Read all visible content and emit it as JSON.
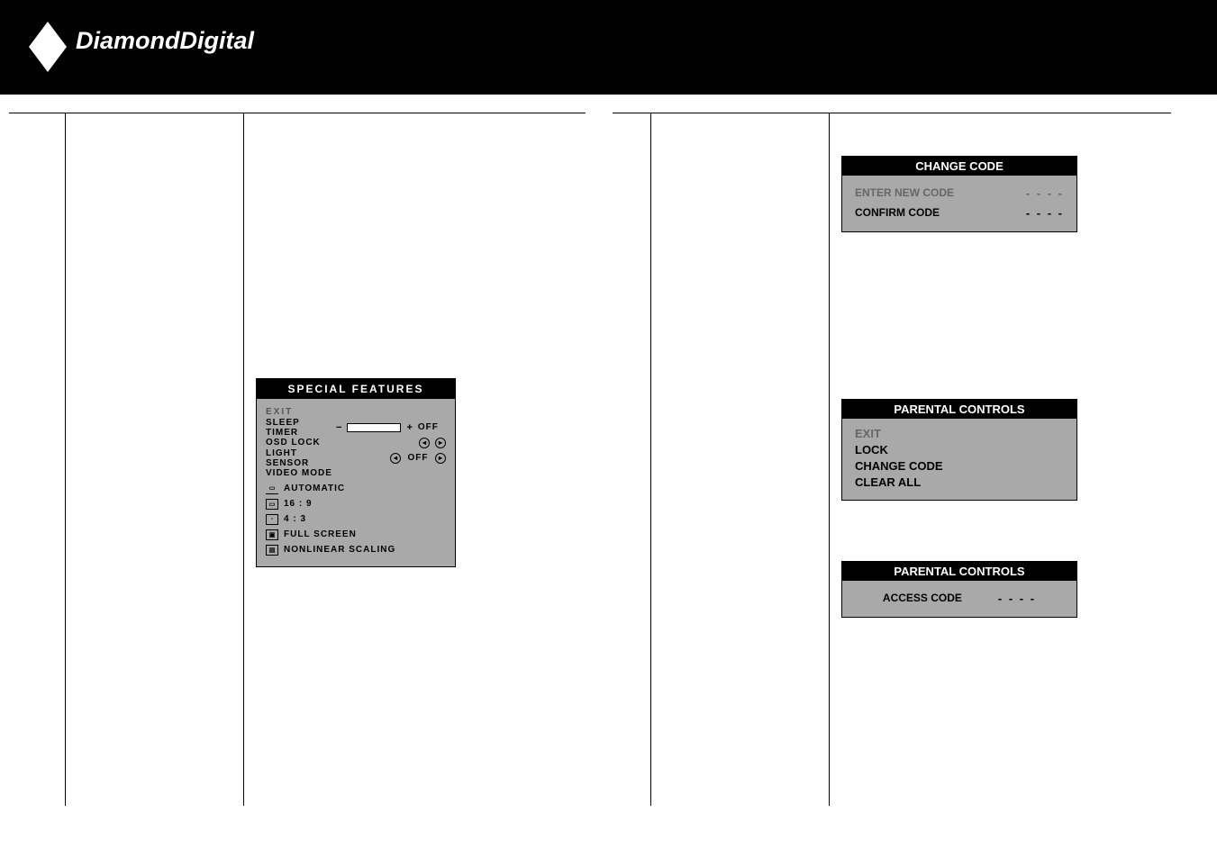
{
  "brand": "DiamondDigital",
  "osd_special": {
    "title": "SPECIAL FEATURES",
    "exit": "EXIT",
    "sleep_timer": "SLEEP TIMER",
    "sleep_minus": "−",
    "sleep_plus": "+",
    "sleep_off": "OFF",
    "osd_lock": "OSD LOCK",
    "light_sensor": "LIGHT SENSOR",
    "ls_off": "OFF",
    "video_mode": "VIDEO MODE",
    "automatic": "AUTOMATIC",
    "r169": "16 : 9",
    "r43": "4 : 3",
    "full": "FULL SCREEN",
    "nonlinear": "NONLINEAR SCALING"
  },
  "osd_change_code": {
    "title": "CHANGE CODE",
    "enter": "ENTER NEW CODE",
    "confirm": "CONFIRM CODE",
    "dashes": "- - - -"
  },
  "osd_parental_menu": {
    "title": "PARENTAL CONTROLS",
    "exit": "EXIT",
    "lock": "LOCK",
    "change": "CHANGE CODE",
    "clear": "CLEAR ALL"
  },
  "osd_parental_access": {
    "title": "PARENTAL CONTROLS",
    "access": "ACCESS CODE",
    "dashes": "- - - -"
  }
}
